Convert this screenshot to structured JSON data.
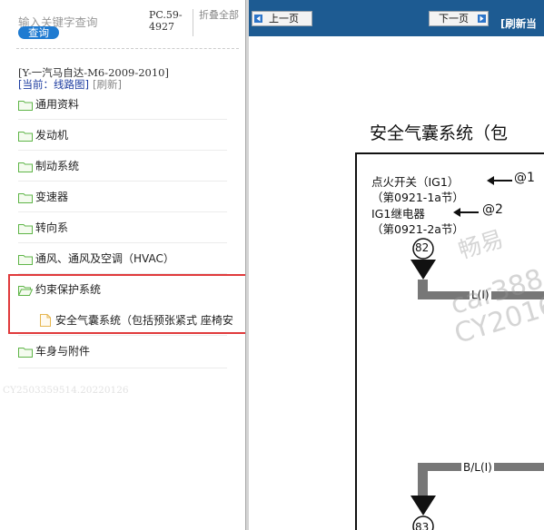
{
  "sidebar": {
    "search": {
      "placeholder": "输入关键字查询",
      "button": "查询"
    },
    "pc_code": "PC.59-4927",
    "fold_all": "折叠全部",
    "car_model": "[Y-一汽马自达-M6-2009-2010]",
    "current": "[当前：线路图]",
    "refresh": "[刷新]",
    "items": [
      {
        "label": "通用资料"
      },
      {
        "label": "发动机"
      },
      {
        "label": "制动系统"
      },
      {
        "label": "变速器"
      },
      {
        "label": "转向系"
      },
      {
        "label": "通风、通风及空调（HVAC）"
      },
      {
        "label": "约束保护系统"
      },
      {
        "label": "车身与附件"
      }
    ],
    "sub_item": "安全气囊系统（包括预张紧式 座椅安",
    "footer_code": "CY2503359514.20220126"
  },
  "viewer": {
    "prev": "上一页",
    "next": "下一页",
    "refresh": "[刷新当",
    "diagram": {
      "title": "安全气囊系统（包",
      "ignition": "点火开关（IG1）",
      "ref1": "@1",
      "ref1_section": "（第0921-1a节）",
      "relay": "IG1继电器",
      "ref2": "@2",
      "ref2_section": "（第0921-2a节）",
      "pin_top": "82",
      "wire_top": "L(I)",
      "wire_bottom": "B/L(I)",
      "pin_bottom": "83"
    },
    "watermark": [
      "畅易",
      "car388.co",
      "CY2016"
    ]
  },
  "colors": {
    "nav_bar": "#1d5b92",
    "accent": "#1f7bd1",
    "highlight": "#e0393b",
    "folder": "#5fb548",
    "file": "#e6b64f"
  }
}
